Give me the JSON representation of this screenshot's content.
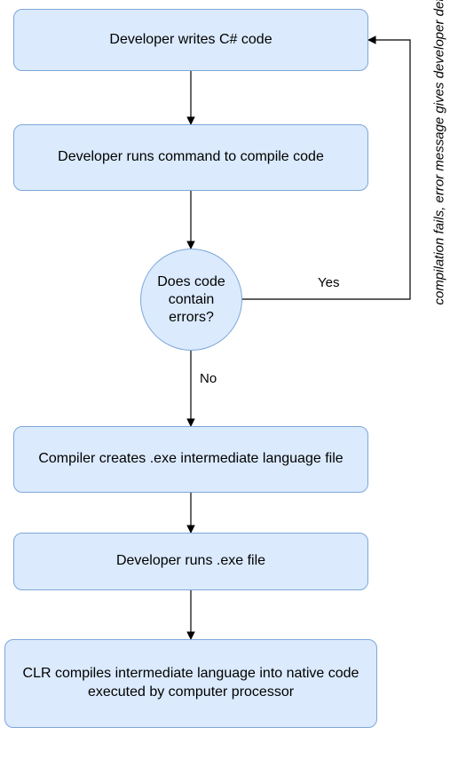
{
  "flowchart": {
    "nodes": {
      "write": "Developer writes C# code",
      "compile": "Developer runs command to compile code",
      "decision": "Does code contain errors?",
      "il": "Compiler creates .exe intermediate language file",
      "run": "Developer runs .exe file",
      "clr": "CLR compiles intermediate language into native code executed by computer processor"
    },
    "edges": {
      "yes": "Yes",
      "no": "No",
      "fail": "compilation fails, error message gives developer details"
    }
  },
  "chart_data": {
    "type": "flowchart",
    "title": "",
    "nodes": [
      {
        "id": "write",
        "kind": "process",
        "label": "Developer writes C# code"
      },
      {
        "id": "compile",
        "kind": "process",
        "label": "Developer runs command to compile code"
      },
      {
        "id": "decision",
        "kind": "decision",
        "label": "Does code contain errors?"
      },
      {
        "id": "il",
        "kind": "process",
        "label": "Compiler creates .exe intermediate language file"
      },
      {
        "id": "run",
        "kind": "process",
        "label": "Developer runs .exe file"
      },
      {
        "id": "clr",
        "kind": "process",
        "label": "CLR compiles intermediate language into native code executed by computer processor"
      }
    ],
    "edges": [
      {
        "from": "write",
        "to": "compile",
        "label": ""
      },
      {
        "from": "compile",
        "to": "decision",
        "label": ""
      },
      {
        "from": "decision",
        "to": "il",
        "label": "No"
      },
      {
        "from": "decision",
        "to": "write",
        "label": "Yes",
        "note": "compilation fails, error message gives developer details"
      },
      {
        "from": "il",
        "to": "run",
        "label": ""
      },
      {
        "from": "run",
        "to": "clr",
        "label": ""
      }
    ]
  }
}
